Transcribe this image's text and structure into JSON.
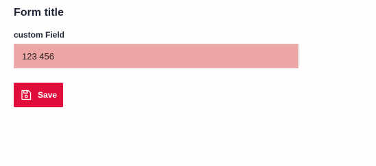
{
  "form": {
    "title": "Form title",
    "fields": [
      {
        "label": "custom Field",
        "value": "123 456"
      }
    ]
  },
  "actions": {
    "save_label": "Save",
    "save_icon": "floppy-disk-icon"
  },
  "colors": {
    "button_background": "#e00c3a",
    "invalid_field_background": "#eca6a6",
    "text": "#1d2536"
  }
}
